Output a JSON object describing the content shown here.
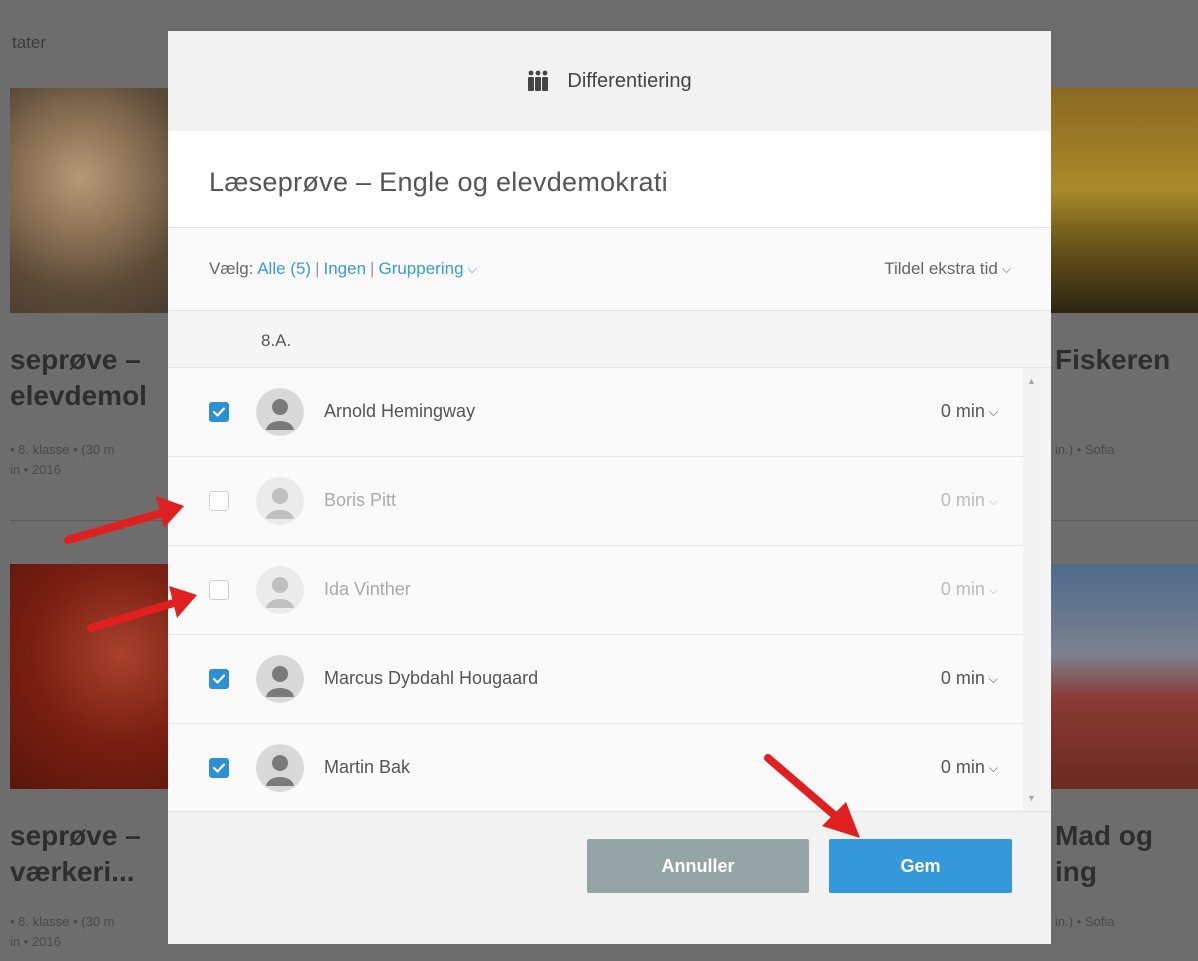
{
  "background": {
    "topbar_text": "tater",
    "cards": [
      {
        "title_line1": "seprøve –",
        "title_line2": "elevdemol",
        "meta_line1": "• 8. klasse • (30 m",
        "meta_line2": "in • 2016"
      },
      {
        "title_line1": "Fiskeren",
        "title_line2": "",
        "meta_line1": "in.) • Sofia",
        "meta_line2": ""
      },
      {
        "title_line1": "seprøve –",
        "title_line2": "værkeri...",
        "meta_line1": "• 8. klasse • (30 m",
        "meta_line2": "in • 2016"
      },
      {
        "title_line1": "Mad og",
        "title_line2": "ing",
        "meta_line1": "in.) • Sofia",
        "meta_line2": ""
      }
    ]
  },
  "modal": {
    "header_title": "Differentiering",
    "header_icon": "group-people-icon",
    "title": "Læseprøve – Engle og elevdemokrati",
    "select": {
      "prefix": "Vælg:",
      "all_label": "Alle (5)",
      "none_label": "Ingen",
      "grouping_label": "Gruppering",
      "extra_time_label": "Tildel ekstra tid"
    },
    "class_label": "8.A.",
    "students": [
      {
        "name": "Arnold Hemingway",
        "time": "0 min",
        "checked": true
      },
      {
        "name": "Boris Pitt",
        "time": "0 min",
        "checked": false
      },
      {
        "name": "Ida Vinther",
        "time": "0 min",
        "checked": false
      },
      {
        "name": "Marcus Dybdahl Hougaard",
        "time": "0 min",
        "checked": true
      },
      {
        "name": "Martin Bak",
        "time": "0 min",
        "checked": true
      }
    ],
    "buttons": {
      "cancel": "Annuller",
      "save": "Gem"
    }
  },
  "colors": {
    "accent": "#3498db",
    "link": "#3a9ad9",
    "cancel": "#95a5a6",
    "checkbox": "#2d8fd5",
    "arrow": "#e02020"
  }
}
